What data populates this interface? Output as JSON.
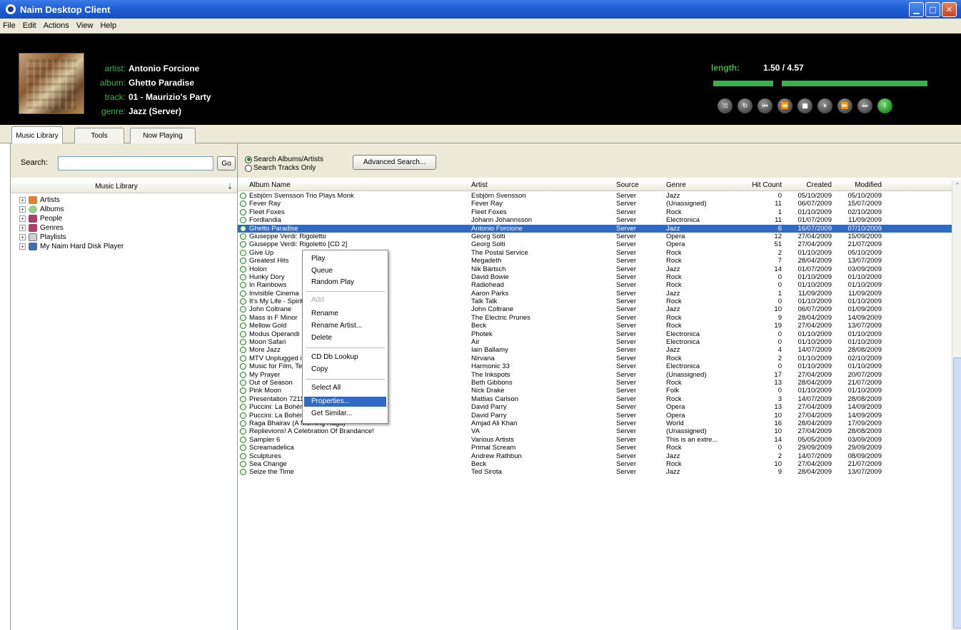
{
  "window": {
    "title": "Naim Desktop Client"
  },
  "menu": [
    "File",
    "Edit",
    "Actions",
    "View",
    "Help"
  ],
  "now_playing": {
    "artist_label": "artist:",
    "artist": "Antonio Forcione",
    "album_label": "album:",
    "album": "Ghetto Paradise",
    "track_label": "track:",
    "track": "01 - Maurizio's Party",
    "genre_label": "genre:",
    "genre": "Jazz (Server)",
    "length_label": "length:",
    "length_value": "1.50 / 4.57",
    "progress_fraction": 0.32
  },
  "tabs": [
    "Music Library",
    "Tools",
    "Now Playing"
  ],
  "search": {
    "label": "Search:",
    "go": "Go",
    "value": ""
  },
  "library": {
    "header": "Music Library",
    "items": [
      "Artists",
      "Albums",
      "People",
      "Genres",
      "Playlists",
      "My Naim Hard Disk Player"
    ]
  },
  "options": {
    "radio1": "Search Albums/Artists",
    "radio2": "Search Tracks Only",
    "advanced": "Advanced Search..."
  },
  "columns": [
    "Album Name",
    "Artist",
    "Source",
    "Genre",
    "Hit Count",
    "Created",
    "Modified"
  ],
  "rows": [
    [
      "Esbjörn Svensson Trio Plays Monk",
      "Esbjörn Svensson",
      "Server",
      "Jazz",
      "0",
      "05/10/2009",
      "05/10/2009"
    ],
    [
      "Fever Ray",
      "Fever Ray",
      "Server",
      "(Unassigned)",
      "11",
      "06/07/2009",
      "15/07/2009"
    ],
    [
      "Fleet Foxes",
      "Fleet Foxes",
      "Server",
      "Rock",
      "1",
      "01/10/2009",
      "02/10/2009"
    ],
    [
      "Fordlandia",
      "Jóhann Jóhannsson",
      "Server",
      "Electronica",
      "11",
      "01/07/2009",
      "11/09/2009"
    ],
    [
      "Ghetto Paradise",
      "Antonio Forcione",
      "Server",
      "Jazz",
      "6",
      "16/07/2009",
      "07/10/2009"
    ],
    [
      "Giuseppe Verdi: Rigoletto",
      "Georg Solti",
      "Server",
      "Opera",
      "12",
      "27/04/2009",
      "15/09/2009"
    ],
    [
      "Giuseppe Verdi: Rigoletto [CD 2]",
      "Georg Solti",
      "Server",
      "Opera",
      "51",
      "27/04/2009",
      "21/07/2009"
    ],
    [
      "Give Up",
      "The Postal Service",
      "Server",
      "Rock",
      "2",
      "01/10/2009",
      "05/10/2009"
    ],
    [
      "Greatest Hits",
      "Megadeth",
      "Server",
      "Rock",
      "7",
      "28/04/2009",
      "13/07/2009"
    ],
    [
      "Holon",
      "Nik Bärtsch",
      "Server",
      "Jazz",
      "14",
      "01/07/2009",
      "03/09/2009"
    ],
    [
      "Hunky Dory",
      "David Bowie",
      "Server",
      "Rock",
      "0",
      "01/10/2009",
      "01/10/2009"
    ],
    [
      "In Rainbows",
      "Radiohead",
      "Server",
      "Rock",
      "0",
      "01/10/2009",
      "01/10/2009"
    ],
    [
      "Invisible Cinema",
      "Aaron Parks",
      "Server",
      "Jazz",
      "1",
      "11/09/2009",
      "11/09/2009"
    ],
    [
      "It's My Life - Spirit of Eden [CD 3]",
      "Talk Talk",
      "Server",
      "Rock",
      "0",
      "01/10/2009",
      "01/10/2009"
    ],
    [
      "John Coltrane",
      "John Coltrane",
      "Server",
      "Jazz",
      "10",
      "06/07/2009",
      "01/09/2009"
    ],
    [
      "Mass in F Minor",
      "The Electric Prunes",
      "Server",
      "Rock",
      "9",
      "28/04/2009",
      "14/09/2009"
    ],
    [
      "Mellow Gold",
      "Beck",
      "Server",
      "Rock",
      "19",
      "27/04/2009",
      "13/07/2009"
    ],
    [
      "Modus Operandi",
      "Photek",
      "Server",
      "Electronica",
      "0",
      "01/10/2009",
      "01/10/2009"
    ],
    [
      "Moon Safari",
      "Air",
      "Server",
      "Electronica",
      "0",
      "01/10/2009",
      "01/10/2009"
    ],
    [
      "More Jazz",
      "Iain Ballamy",
      "Server",
      "Jazz",
      "4",
      "14/07/2009",
      "28/08/2009"
    ],
    [
      "MTV Unplugged in New York",
      "Nirvana",
      "Server",
      "Rock",
      "2",
      "01/10/2009",
      "02/10/2009"
    ],
    [
      "Music for Film, Television and Radio, Vol. 1",
      "Harmonic 33",
      "Server",
      "Electronica",
      "0",
      "01/10/2009",
      "01/10/2009"
    ],
    [
      "My Prayer",
      "The Inkspots",
      "Server",
      "(Unassigned)",
      "17",
      "27/04/2009",
      "20/07/2009"
    ],
    [
      "Out of Season",
      "Beth Gibbons",
      "Server",
      "Rock",
      "13",
      "28/04/2009",
      "21/07/2009"
    ],
    [
      "Pink Moon",
      "Nick Drake",
      "Server",
      "Folk",
      "0",
      "01/10/2009",
      "01/10/2009"
    ],
    [
      "Presentation 7211",
      "Mattias Carlson",
      "Server",
      "Rock",
      "3",
      "14/07/2009",
      "28/08/2009"
    ],
    [
      "Puccini: La Bohème",
      "David Parry",
      "Server",
      "Opera",
      "13",
      "27/04/2009",
      "14/09/2009"
    ],
    [
      "Puccini: La Bohème [CD 2]",
      "David Parry",
      "Server",
      "Opera",
      "10",
      "27/04/2009",
      "14/09/2009"
    ],
    [
      "Raga Bhairav (A Morning Raga)",
      "Amjad Ali Khan",
      "Server",
      "World",
      "16",
      "28/04/2009",
      "17/09/2009"
    ],
    [
      "Replievions! A Celebration Of Brandance!",
      "VA",
      "Server",
      "(Unassigned)",
      "10",
      "27/04/2009",
      "28/08/2009"
    ],
    [
      "Sampler 6",
      "Various Artists",
      "Server",
      "This is an extre...",
      "14",
      "05/05/2009",
      "03/09/2009"
    ],
    [
      "Screamadelica",
      "Primal Scream",
      "Server",
      "Rock",
      "0",
      "29/09/2009",
      "29/09/2009"
    ],
    [
      "Sculptures",
      "Andrew Rathbun",
      "Server",
      "Jazz",
      "2",
      "14/07/2009",
      "08/09/2009"
    ],
    [
      "Sea Change",
      "Beck",
      "Server",
      "Rock",
      "10",
      "27/04/2009",
      "21/07/2009"
    ],
    [
      "Seize the Time",
      "Ted Sirota",
      "Server",
      "Jazz",
      "9",
      "28/04/2009",
      "13/07/2009"
    ]
  ],
  "context_menu": {
    "items": [
      "Play",
      "Queue",
      "Random Play",
      "Add",
      "Rename",
      "Rename Artist...",
      "Delete",
      "CD Db Lookup",
      "Copy",
      "Select All",
      "Properties...",
      "Get Similar..."
    ]
  }
}
